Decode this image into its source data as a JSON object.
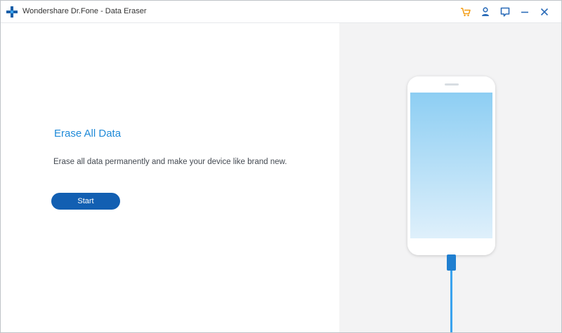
{
  "window": {
    "title": "Wondershare Dr.Fone - Data Eraser"
  },
  "toolbar": {
    "icons": [
      "cart-icon",
      "user-icon",
      "feedback-icon",
      "minimize-icon",
      "close-icon"
    ]
  },
  "main": {
    "heading": "Erase All Data",
    "description": "Erase all data permanently and make your device like brand new.",
    "start_label": "Start"
  },
  "colors": {
    "accent": "#1f8ad8",
    "button": "#125fb2",
    "cart": "#f39c12",
    "icons": "#2b6cb8",
    "cable": "#2f9be8"
  }
}
